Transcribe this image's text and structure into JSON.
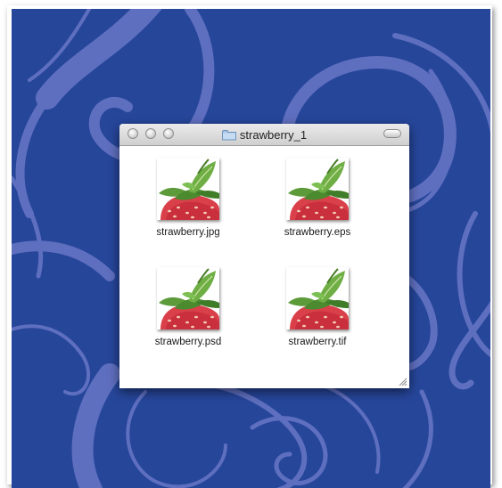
{
  "window": {
    "title": "strawberry_1",
    "title_icon": "folder-icon"
  },
  "files": [
    {
      "name": "strawberry.jpg",
      "icon": "strawberry-thumbnail"
    },
    {
      "name": "strawberry.eps",
      "icon": "strawberry-thumbnail"
    },
    {
      "name": "strawberry.psd",
      "icon": "strawberry-thumbnail"
    },
    {
      "name": "strawberry.tif",
      "icon": "strawberry-thumbnail"
    }
  ],
  "colors": {
    "desktop": "#26469a",
    "swirl": "#5f6fbf",
    "window_bg": "#ffffff"
  }
}
